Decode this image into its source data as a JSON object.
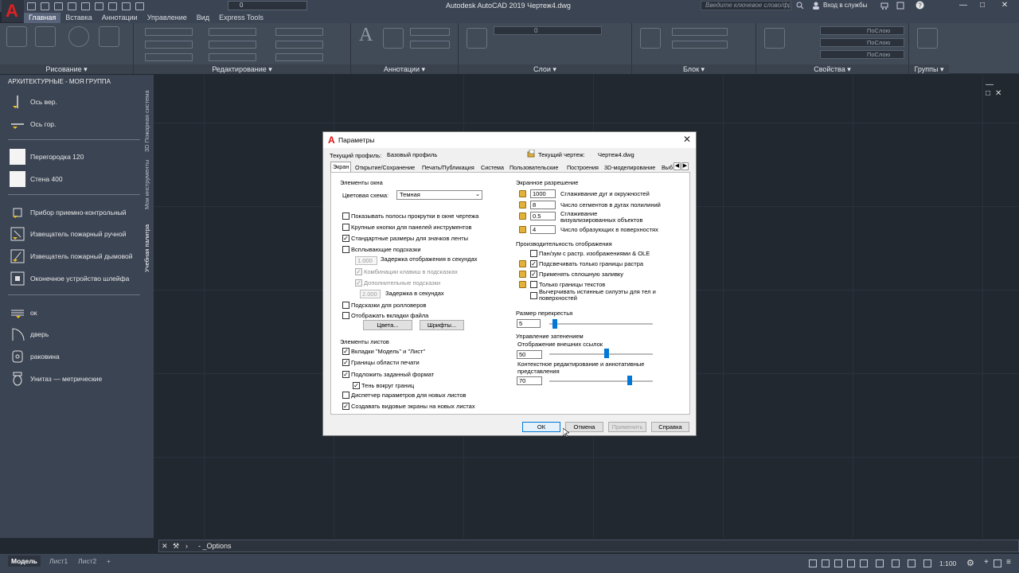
{
  "window": {
    "title": "Autodesk AutoCAD 2019    Чертеж4.dwg",
    "search_placeholder": "Введите ключевое слово/фразу",
    "login": "Вход в службы",
    "qat_layer": "0"
  },
  "ribbon": {
    "tabs": [
      "Главная",
      "Вставка",
      "Аннотации",
      "Управление",
      "Вид",
      "Express Tools"
    ],
    "panels": [
      "Рисование ▾",
      "Редактирование ▾",
      "Аннотации ▾",
      "Слои ▾",
      "Блок ▾",
      "Свойства ▾",
      "Группы ▾"
    ],
    "properties_rows": [
      "ПоСлою",
      "ПоСлою",
      "ПоСлою"
    ],
    "layer_value": "0"
  },
  "palette": {
    "title": "АРХИТЕКТУРНЫЕ - МОЯ ГРУППА",
    "side_tabs": [
      "Учебная палитра",
      "Мои инструменты",
      "3D Пожарная система"
    ],
    "items": [
      "Ось вер.",
      "Ось гор.",
      "Перегородка 120",
      "Стена 400",
      "Прибор приемно-контрольный",
      "Извещатель пожарный ручной",
      "Извещатель пожарный дымовой",
      "Оконечное устройство шлейфа",
      "ок",
      "дверь",
      "раковина",
      "Унитаз — метрические"
    ]
  },
  "command_line": {
    "text": "- _Options"
  },
  "status": {
    "tabs": [
      "Модель",
      "Лист1",
      "Лист2",
      "+"
    ],
    "scale": "1:100"
  },
  "dialog": {
    "title": "Параметры",
    "profile_label": "Текущий профиль:",
    "profile_value": "Базовый профиль",
    "drawing_label": "Текущий чертеж:",
    "drawing_value": "Чертеж4.dwg",
    "tabs": [
      "Экран",
      "Открытие/Сохранение",
      "Печать/Публикация",
      "Система",
      "Пользовательские",
      "Построения",
      "3D-моделирование",
      "Выб"
    ],
    "window_elements": {
      "title": "Элементы окна",
      "color_scheme_label": "Цветовая схема:",
      "color_scheme_value": "Темная",
      "checks": [
        {
          "label": "Показывать полосы прокрутки в окне чертежа",
          "checked": false
        },
        {
          "label": "Крупные кнопки для панелей инструментов",
          "checked": false
        },
        {
          "label": "Стандартные размеры для значков ленты",
          "checked": true
        },
        {
          "label": "Всплывающие подсказки",
          "checked": false
        }
      ],
      "delay_value": "1.000",
      "delay_label": "Задержка отображения в секундах",
      "shortcut_label": "Комбинации клавиш в подсказках",
      "extended_label": "Дополнительные подсказки",
      "delay2_value": "2.000",
      "delay2_label": "Задержка в секундах",
      "rollover_label": "Подсказки для ролловеров",
      "filetabs_label": "Отображать вкладки файла",
      "colors_btn": "Цвета...",
      "fonts_btn": "Шрифты..."
    },
    "layout_elements": {
      "title": "Элементы листов",
      "checks": [
        {
          "label": "Вкладки \"Модель\" и \"Лист\"",
          "checked": true
        },
        {
          "label": "Границы области печати",
          "checked": true
        },
        {
          "label": "Подложить заданный формат",
          "checked": true
        },
        {
          "label": "Тень вокруг границ",
          "checked": true
        },
        {
          "label": "Диспетчер параметров для новых листов",
          "checked": false
        },
        {
          "label": "Создавать видовые экраны на новых листах",
          "checked": true
        }
      ]
    },
    "resolution": {
      "title": "Экранное разрешение",
      "rows": [
        {
          "value": "1000",
          "label": "Сглаживание дуг и окружностей"
        },
        {
          "value": "8",
          "label": "Число сегментов в дугах полилиний"
        },
        {
          "value": "0.5",
          "label": "Сглаживание визуализированных объектов"
        },
        {
          "value": "4",
          "label": "Число образующих в поверхностях"
        }
      ]
    },
    "performance": {
      "title": "Производительность отображения",
      "checks": [
        {
          "label": "Пан/зум с растр. изображениями & OLE",
          "checked": false
        },
        {
          "label": "Подсвечивать только границы растра",
          "checked": true
        },
        {
          "label": "Применять сплошную заливку",
          "checked": true
        },
        {
          "label": "Только границы текстов",
          "checked": false
        },
        {
          "label": "Вычерчивать истинные силуэты для тел и поверхностей",
          "checked": false
        }
      ]
    },
    "crosshair": {
      "title": "Размер перекрестья",
      "value": "5"
    },
    "fade": {
      "title": "Управление затенением",
      "xref_label": "Отображение внешних ссылок",
      "xref_value": "50",
      "inplace_label": "Контекстное редактирование и аннотативные представления",
      "inplace_value": "70"
    },
    "buttons": {
      "ok": "ОК",
      "cancel": "Отмена",
      "apply": "Применить",
      "help": "Справка"
    }
  }
}
